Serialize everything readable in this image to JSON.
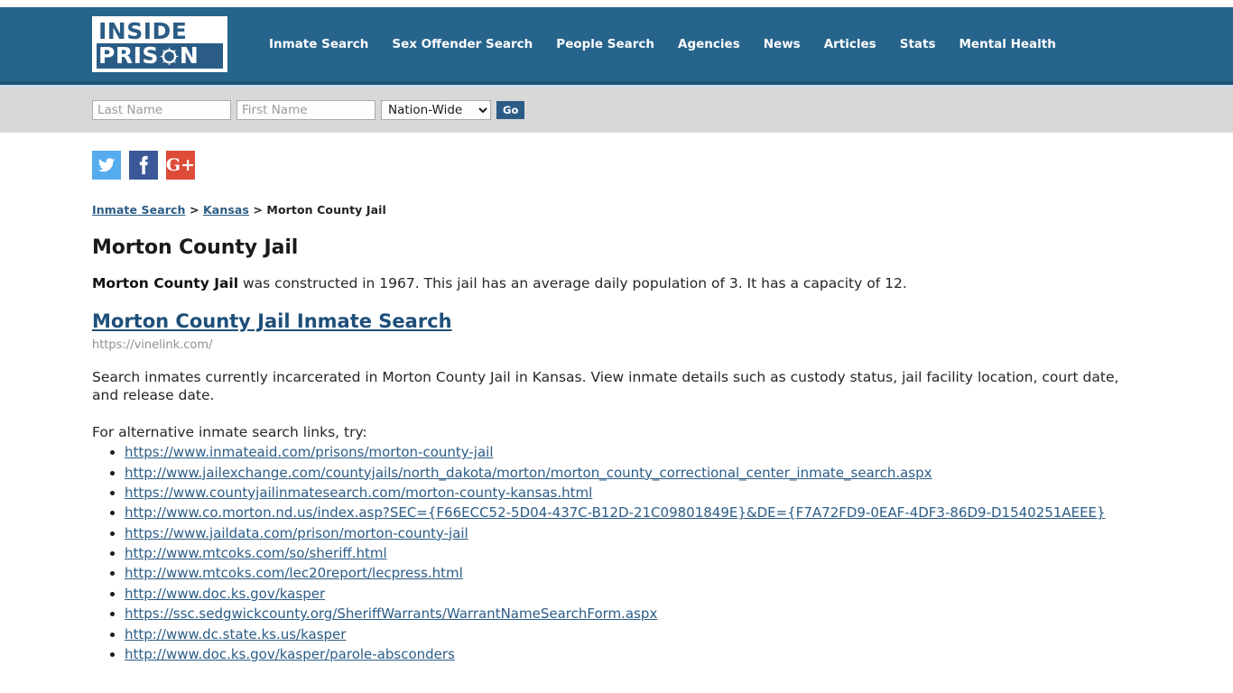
{
  "header": {
    "logo": {
      "line1": "INSIDE",
      "line2_before": "PRIS",
      "line2_after": "N",
      "icon": "barbed-wire-circle-icon"
    },
    "nav": [
      {
        "label": "Inmate Search"
      },
      {
        "label": "Sex Offender Search"
      },
      {
        "label": "People Search"
      },
      {
        "label": "Agencies"
      },
      {
        "label": "News"
      },
      {
        "label": "Articles"
      },
      {
        "label": "Stats"
      },
      {
        "label": "Mental Health"
      }
    ],
    "brand_color": "#26648c"
  },
  "search": {
    "last_name_placeholder": "Last Name",
    "last_name_value": "",
    "first_name_placeholder": "First Name",
    "first_name_value": "",
    "scope_selected": "Nation-Wide",
    "scope_options": [
      "Nation-Wide"
    ],
    "go_label": "Go"
  },
  "social": [
    {
      "name": "twitter-share-icon",
      "glyph": "twitter",
      "color": "#55acee"
    },
    {
      "name": "facebook-share-icon",
      "glyph": "facebook",
      "color": "#3b5998"
    },
    {
      "name": "google-plus-share-icon",
      "glyph": "G+",
      "color": "#dd4b39"
    }
  ],
  "breadcrumb": {
    "items": [
      {
        "label": "Inmate Search",
        "link": true
      },
      {
        "label": "Kansas",
        "link": true
      },
      {
        "label": "Morton County Jail",
        "link": false
      }
    ],
    "separator": ">"
  },
  "main": {
    "page_title": "Morton County Jail",
    "description_bold": "Morton County Jail",
    "description_rest": " was constructed in 1967. This jail has an average daily population of 3. It has a capacity of 12.",
    "result": {
      "title": "Morton County Jail Inmate Search",
      "url": "https://vinelink.com/",
      "snippet": "Search inmates currently incarcerated in Morton County Jail in Kansas. View inmate details such as custody status, jail facility location, court date, and release date."
    },
    "alt_intro": "For alternative inmate search links, try:",
    "alt_links": [
      "https://www.inmateaid.com/prisons/morton-county-jail",
      "http://www.jailexchange.com/countyjails/north_dakota/morton/morton_county_correctional_center_inmate_search.aspx",
      "https://www.countyjailinmatesearch.com/morton-county-kansas.html",
      "http://www.co.morton.nd.us/index.asp?SEC={F66ECC52-5D04-437C-B12D-21C09801849E}&DE={F7A72FD9-0EAF-4DF3-86D9-D1540251AEEE}",
      "https://www.jaildata.com/prison/morton-county-jail",
      "http://www.mtcoks.com/so/sheriff.html",
      "http://www.mtcoks.com/lec20report/lecpress.html",
      "http://www.doc.ks.gov/kasper",
      "https://ssc.sedgwickcounty.org/SheriffWarrants/WarrantNameSearchForm.aspx",
      "http://www.dc.state.ks.us/kasper",
      "http://www.doc.ks.gov/kasper/parole-absconders"
    ]
  }
}
